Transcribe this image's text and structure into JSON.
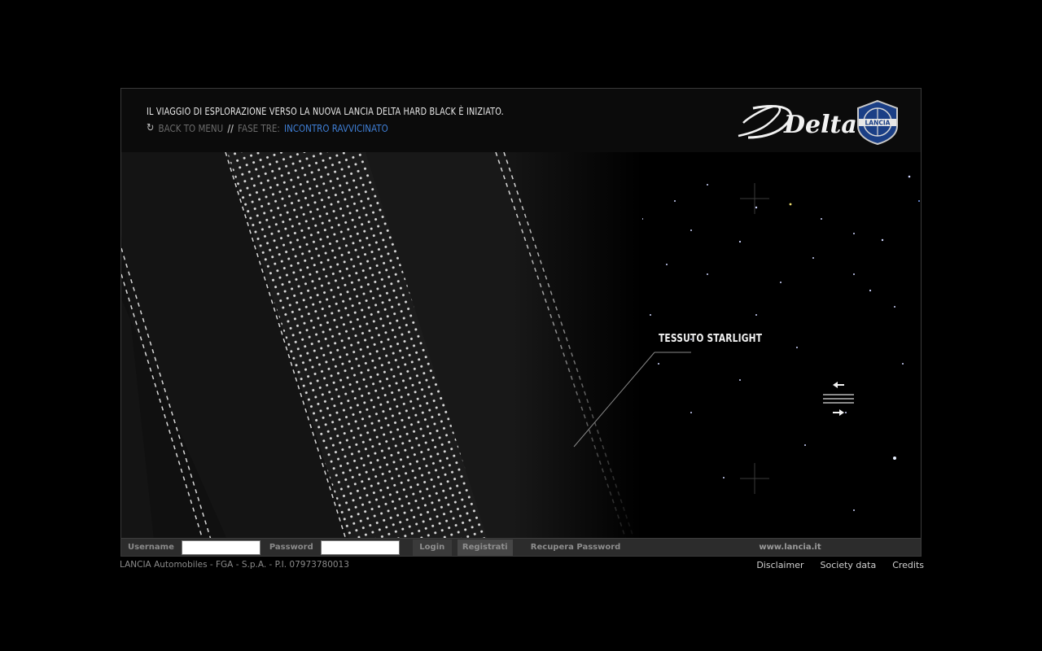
{
  "header": {
    "headline": "IL VIAGGIO DI ESPLORAZIONE VERSO LA NUOVA LANCIA DELTA HARD BLACK È INIZIATO.",
    "back_label": "BACK TO MENU",
    "separator": "//",
    "phase_label": "FASE TRE:",
    "phase_name": "INCONTRO RAVVICINATO",
    "logo_text": "Delta",
    "badge_text": "LANCIA"
  },
  "scene": {
    "callout": "TESSUTO STARLIGHT",
    "swap_icon": "swap-arrows-icon"
  },
  "login_bar": {
    "username_label": "Username",
    "username_value": "",
    "password_label": "Password",
    "password_value": "",
    "login_button": "Login",
    "register_button": "Registrati",
    "recover_link": "Recupera Password",
    "site_link": "www.lancia.it"
  },
  "footer": {
    "company": "LANCIA Automobiles - FGA - S.p.A. - P.I. 07973780013",
    "links": [
      "Disclaimer",
      "Society data",
      "Credits"
    ]
  },
  "colors": {
    "accent_blue": "#3f7fd6",
    "background": "#000000",
    "bar": "#2c2c2c"
  }
}
